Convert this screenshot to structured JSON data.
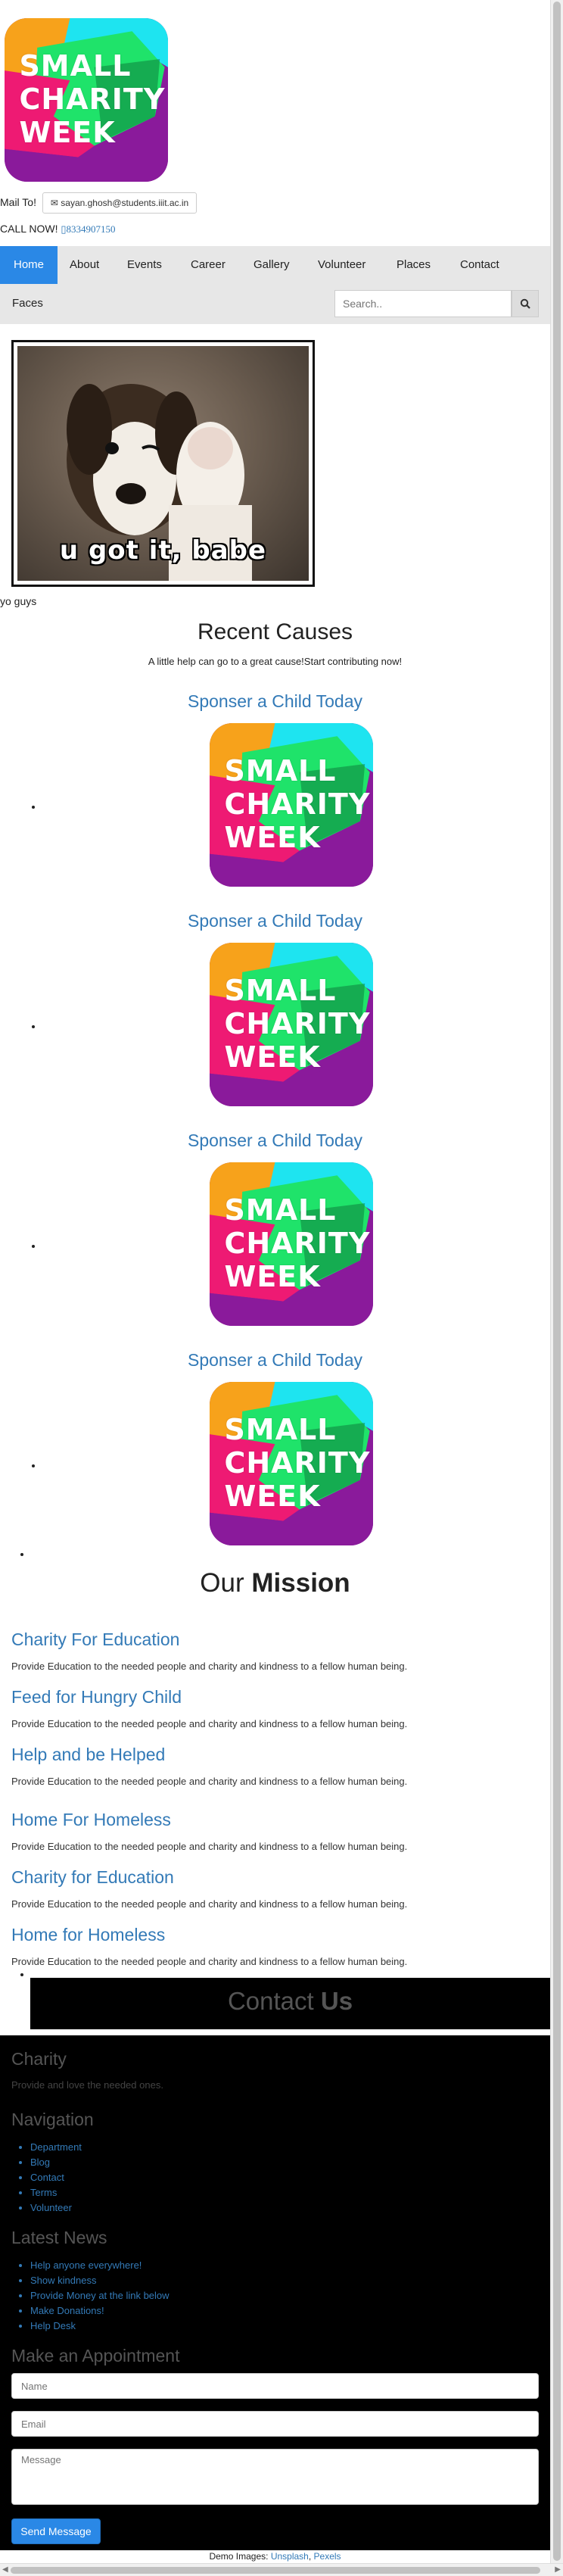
{
  "brand": {
    "logo_lines": [
      "SMALL",
      "CHARITY",
      "WEEK"
    ]
  },
  "header": {
    "mail_label": "Mail To!",
    "mail_address": "sayan.ghosh@students.iiit.ac.in",
    "call_label": "CALL NOW!",
    "phone": "8334907150"
  },
  "nav": {
    "items": [
      "Home",
      "About",
      "Events",
      "Career",
      "Gallery",
      "Volunteer",
      "Places",
      "Contact",
      "Faces"
    ],
    "active": "Home",
    "search_placeholder": "Search.."
  },
  "hero": {
    "image_text": "u got it, babe",
    "caption": "yo guys"
  },
  "causes": {
    "title": "Recent Causes",
    "subtitle": "A little help can go to a great cause!Start contributing now!",
    "items": [
      {
        "title": "Sponser a Child Today"
      },
      {
        "title": "Sponser a Child Today"
      },
      {
        "title": "Sponser a Child Today"
      },
      {
        "title": "Sponser a Child Today"
      }
    ]
  },
  "mission": {
    "title_plain": "Our",
    "title_bold": "Mission",
    "items": [
      {
        "title": "Charity For Education",
        "text": "Provide Education to the needed people and charity and kindness to a fellow human being."
      },
      {
        "title": "Feed for Hungry Child",
        "text": "Provide Education to the needed people and charity and kindness to a fellow human being."
      },
      {
        "title": "Help and be Helped",
        "text": "Provide Education to the needed people and charity and kindness to a fellow human being."
      },
      {
        "title": "Home For Homeless",
        "text": "Provide Education to the needed people and charity and kindness to a fellow human being."
      },
      {
        "title": "Charity for Education",
        "text": "Provide Education to the needed people and charity and kindness to a fellow human being."
      },
      {
        "title": "Home for Homeless",
        "text": "Provide Education to the needed people and charity and kindness to a fellow human being."
      }
    ]
  },
  "contact_band": {
    "plain": "Contact",
    "bold": "Us"
  },
  "footer": {
    "charity_title": "Charity",
    "charity_text": "Provide and love the needed ones.",
    "nav_title": "Navigation",
    "nav_links": [
      "Department",
      "Blog",
      "Contact",
      "Terms",
      "Volunteer"
    ],
    "news_title": "Latest News",
    "news_links": [
      "Help anyone everywhere!",
      "Show kindness",
      "Provide Money at the link below",
      "Make Donations!",
      "Help Desk"
    ],
    "appointment_title": "Make an Appointment",
    "name_placeholder": "Name",
    "email_placeholder": "Email",
    "message_placeholder": "Message",
    "send_label": "Send Message"
  },
  "credits": {
    "label": "Demo Images:",
    "link1": "Unsplash",
    "separator": ",",
    "link2": "Pexels"
  },
  "colors": {
    "accent": "#2a88e6",
    "link": "#337ab7",
    "navbar": "#e7e7e7",
    "footer": "#000000"
  }
}
